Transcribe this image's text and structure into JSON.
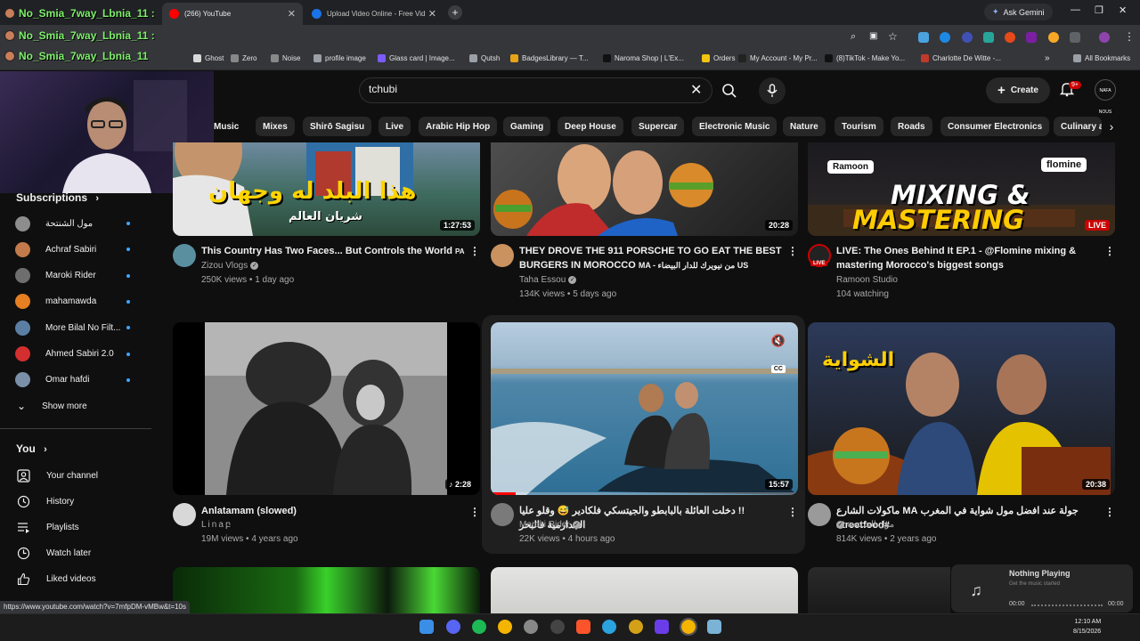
{
  "browser": {
    "tabs": [
      {
        "label": "(266) YouTube",
        "color": "#ff0000"
      },
      {
        "label": "Upload Video Online - Free Vid",
        "color": "#1a73e8"
      }
    ],
    "ask_gemini": "Ask Gemini",
    "bookmarks": [
      {
        "label": "Ghost",
        "color": "#d8d8d8"
      },
      {
        "label": "Zero",
        "color": "#888888"
      },
      {
        "label": "Noise",
        "color": "#888888"
      },
      {
        "label": "profile image",
        "color": "#9aa0a6"
      },
      {
        "label": "Glass card | Image...",
        "color": "#7c5cff"
      },
      {
        "label": "Qutsh",
        "color": "#9aa0a6"
      },
      {
        "label": "BadgesLibrary — T...",
        "color": "#e8a317"
      },
      {
        "label": "Naroma Shop | L'Ex...",
        "color": "#111111"
      },
      {
        "label": "Orders",
        "color": "#f1c40f"
      },
      {
        "label": "My Account - My Pr...",
        "color": "#222222"
      },
      {
        "label": "(8)TikTok - Make Yo...",
        "color": "#111111"
      },
      {
        "label": "Charlotte De Witte -...",
        "color": "#c0392b"
      }
    ],
    "all_bookmarks": "All Bookmarks",
    "status_url": "https://www.youtube.com/watch?v=7mfpDM-vMBw&t=10s"
  },
  "chat_overlay": {
    "lines": [
      "No_Smia_7way_Lbnia_11 :",
      "No_Smia_7way_Lbnia_11 :",
      "No_Smia_7way_Lbnia_11"
    ]
  },
  "header": {
    "search_value": "tchubi",
    "create_label": "Create",
    "notifications_badge": "9+",
    "avatar_text": "NAFA NOUS"
  },
  "chips": [
    "Music",
    "Mixes",
    "Shirō Sagisu",
    "Live",
    "Arabic Hip Hop",
    "Gaming",
    "Deep House",
    "Supercar",
    "Electronic Music",
    "Nature",
    "Tourism",
    "Roads",
    "Consumer Electronics",
    "Culinary a"
  ],
  "sidebar": {
    "subscriptions_title": "Subscriptions",
    "subscriptions": [
      {
        "name": "مول الشنتحة",
        "color": "#8d8d8d"
      },
      {
        "name": "Achraf Sabiri",
        "color": "#c27a4a"
      },
      {
        "name": "Maroki Rider",
        "color": "#6e6e6e"
      },
      {
        "name": "mahamawda",
        "color": "#e67e22"
      },
      {
        "name": "More Bilal No Filt...",
        "color": "#5b7fa3"
      },
      {
        "name": "Ahmed Sabiri 2.0",
        "color": "#d32f2f"
      },
      {
        "name": "Omar hafdi",
        "color": "#7a8fa8"
      }
    ],
    "show_more": "Show more",
    "you_title": "You",
    "you_items": [
      "Your channel",
      "History",
      "Playlists",
      "Watch later",
      "Liked videos"
    ]
  },
  "videos": [
    {
      "title": "This Country Has Two Faces... But Controls the World",
      "title_suffix": "PA",
      "channel": "Zizou Vlogs",
      "verified": true,
      "views": "250K views",
      "age": "1 day ago",
      "duration": "1:27:53",
      "thumb_text": "هذا البلد له وجهان",
      "thumb_sub": "شريان العالم"
    },
    {
      "title": "THEY DROVE THE 911 PORSCHE TO GO EAT THE BEST BURGERS IN MOROCCO",
      "title_suffix": "MA - من نيويرك للدار البيضاء US",
      "channel": "Taha Essou",
      "verified": true,
      "views": "134K views",
      "age": "5 days ago",
      "duration": "20:28"
    },
    {
      "title": "LIVE: The Ones Behind It EP.1 - @Flomine mixing & mastering Morocco's biggest songs",
      "title_suffix": "",
      "channel": "Ramoon Studio",
      "verified": false,
      "views": "104 watching",
      "age": "",
      "duration": "LIVE",
      "thumb_text": "MIXING &",
      "thumb_text2": "MASTERING",
      "tag1": "Ramoon",
      "tag2": "flomine",
      "avatar_badge": "LIVE"
    },
    {
      "title": "Anlatamam (slowed)",
      "title_suffix": "",
      "channel": "Linaբ",
      "verified": false,
      "views": "19M views",
      "age": "4 years ago",
      "duration": "2:28"
    },
    {
      "title": "!! دخلت العائلة بالبابطو والجيتسكي فلكادير 😅 وقلو عليا الجدارمية فالبحر",
      "title_suffix": "",
      "channel": "Maroki Rider",
      "verified": true,
      "views": "22K views",
      "age": "4 hours ago",
      "duration": "15:57",
      "cc": "CC"
    },
    {
      "title": "جولة عند افضل مول شواية في المغرب MA ماكولات الشارع #streetfood",
      "title_suffix": "",
      "channel": "مول الشنتحة",
      "verified": true,
      "views": "814K views",
      "age": "2 years ago",
      "duration": "20:38",
      "thumb_text": "الشواية"
    }
  ],
  "media_widget": {
    "title": "Nothing Playing",
    "subtitle": "Get the music started",
    "time_start": "00:00",
    "time_end": "00:00"
  },
  "clock": {
    "time": "12:10 AM",
    "date": "8/15/2026"
  }
}
